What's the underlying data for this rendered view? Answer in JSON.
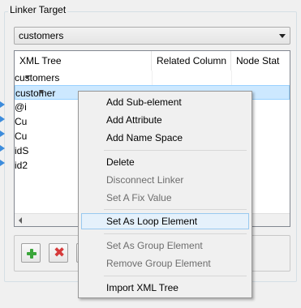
{
  "group": {
    "title": "Linker Target"
  },
  "combo": {
    "value": "customers"
  },
  "tree": {
    "columns": [
      "XML Tree",
      "Related Column",
      "Node Stat"
    ],
    "rows": [
      {
        "label": "customers"
      },
      {
        "label": "customer"
      },
      {
        "label": "@i"
      },
      {
        "label": "Cu"
      },
      {
        "label": "Cu"
      },
      {
        "label": "idS"
      },
      {
        "label": "id2"
      }
    ]
  },
  "context_menu": {
    "items": [
      {
        "label": "Add Sub-element"
      },
      {
        "label": "Add Attribute"
      },
      {
        "label": "Add Name Space"
      },
      {
        "label": "Delete"
      },
      {
        "label": "Disconnect Linker"
      },
      {
        "label": "Set A Fix Value"
      },
      {
        "label": "Set As Loop Element"
      },
      {
        "label": "Set As Group Element"
      },
      {
        "label": "Remove Group Element"
      },
      {
        "label": "Import XML Tree"
      }
    ]
  },
  "icons": {
    "add": "plus-icon",
    "remove": "delete-x-icon",
    "accent": "#3aa63a",
    "danger": "#d63a3a",
    "link_marker": "#3c8cdc"
  }
}
